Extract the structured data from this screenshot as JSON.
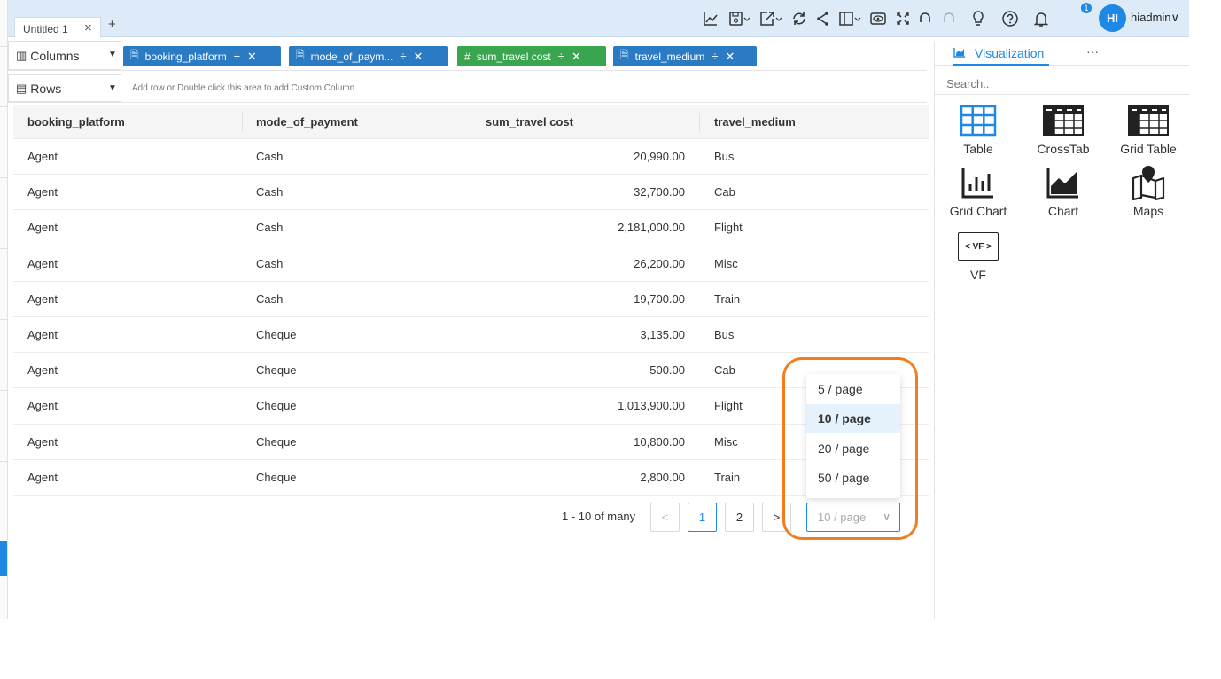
{
  "tab": {
    "title": "Untitled 1",
    "close_icon": "×",
    "add_icon": "+"
  },
  "user": {
    "initials": "HI",
    "name": "hiadmin",
    "notifications": "1"
  },
  "shelves": {
    "columns_label": "Columns",
    "rows_label": "Rows",
    "rows_hint": "Add row or Double click this area to add Custom Column",
    "pills": [
      {
        "label": "booking_platform",
        "color": "#2b7ac4",
        "icon": "doc-icon"
      },
      {
        "label": "mode_of_paym...",
        "color": "#2b7ac4",
        "icon": "doc-icon"
      },
      {
        "label": "sum_travel cost",
        "color": "#3aa54f",
        "icon": "hash-icon"
      },
      {
        "label": "travel_medium",
        "color": "#2b7ac4",
        "icon": "doc-icon"
      }
    ]
  },
  "table": {
    "headers": [
      "booking_platform",
      "mode_of_payment",
      "sum_travel cost",
      "travel_medium"
    ],
    "rows": [
      [
        "Agent",
        "Cash",
        "20,990.00",
        "Bus"
      ],
      [
        "Agent",
        "Cash",
        "32,700.00",
        "Cab"
      ],
      [
        "Agent",
        "Cash",
        "2,181,000.00",
        "Flight"
      ],
      [
        "Agent",
        "Cash",
        "26,200.00",
        "Misc"
      ],
      [
        "Agent",
        "Cash",
        "19,700.00",
        "Train"
      ],
      [
        "Agent",
        "Cheque",
        "3,135.00",
        "Bus"
      ],
      [
        "Agent",
        "Cheque",
        "500.00",
        "Cab"
      ],
      [
        "Agent",
        "Cheque",
        "1,013,900.00",
        "Flight"
      ],
      [
        "Agent",
        "Cheque",
        "10,800.00",
        "Misc"
      ],
      [
        "Agent",
        "Cheque",
        "2,800.00",
        "Train"
      ]
    ]
  },
  "pagination": {
    "total_text": "1 - 10 of many",
    "prev": "<",
    "next": ">",
    "pages": [
      "1",
      "2"
    ],
    "current_page": "1",
    "page_size": "10 / page",
    "page_size_options": [
      "5 / page",
      "10 / page",
      "20 / page",
      "50 / page"
    ]
  },
  "visualization": {
    "tab_label": "Visualization",
    "more": "···",
    "search_placeholder": "Search..",
    "items": [
      "Table",
      "CrossTab",
      "Grid Table",
      "Grid Chart",
      "Chart",
      "Maps",
      "VF"
    ],
    "vf_icon_text": "< VF >"
  },
  "colors": {
    "accent": "#1e88e5",
    "highlight": "#f07d1f",
    "topbar": "#dcebf7"
  }
}
